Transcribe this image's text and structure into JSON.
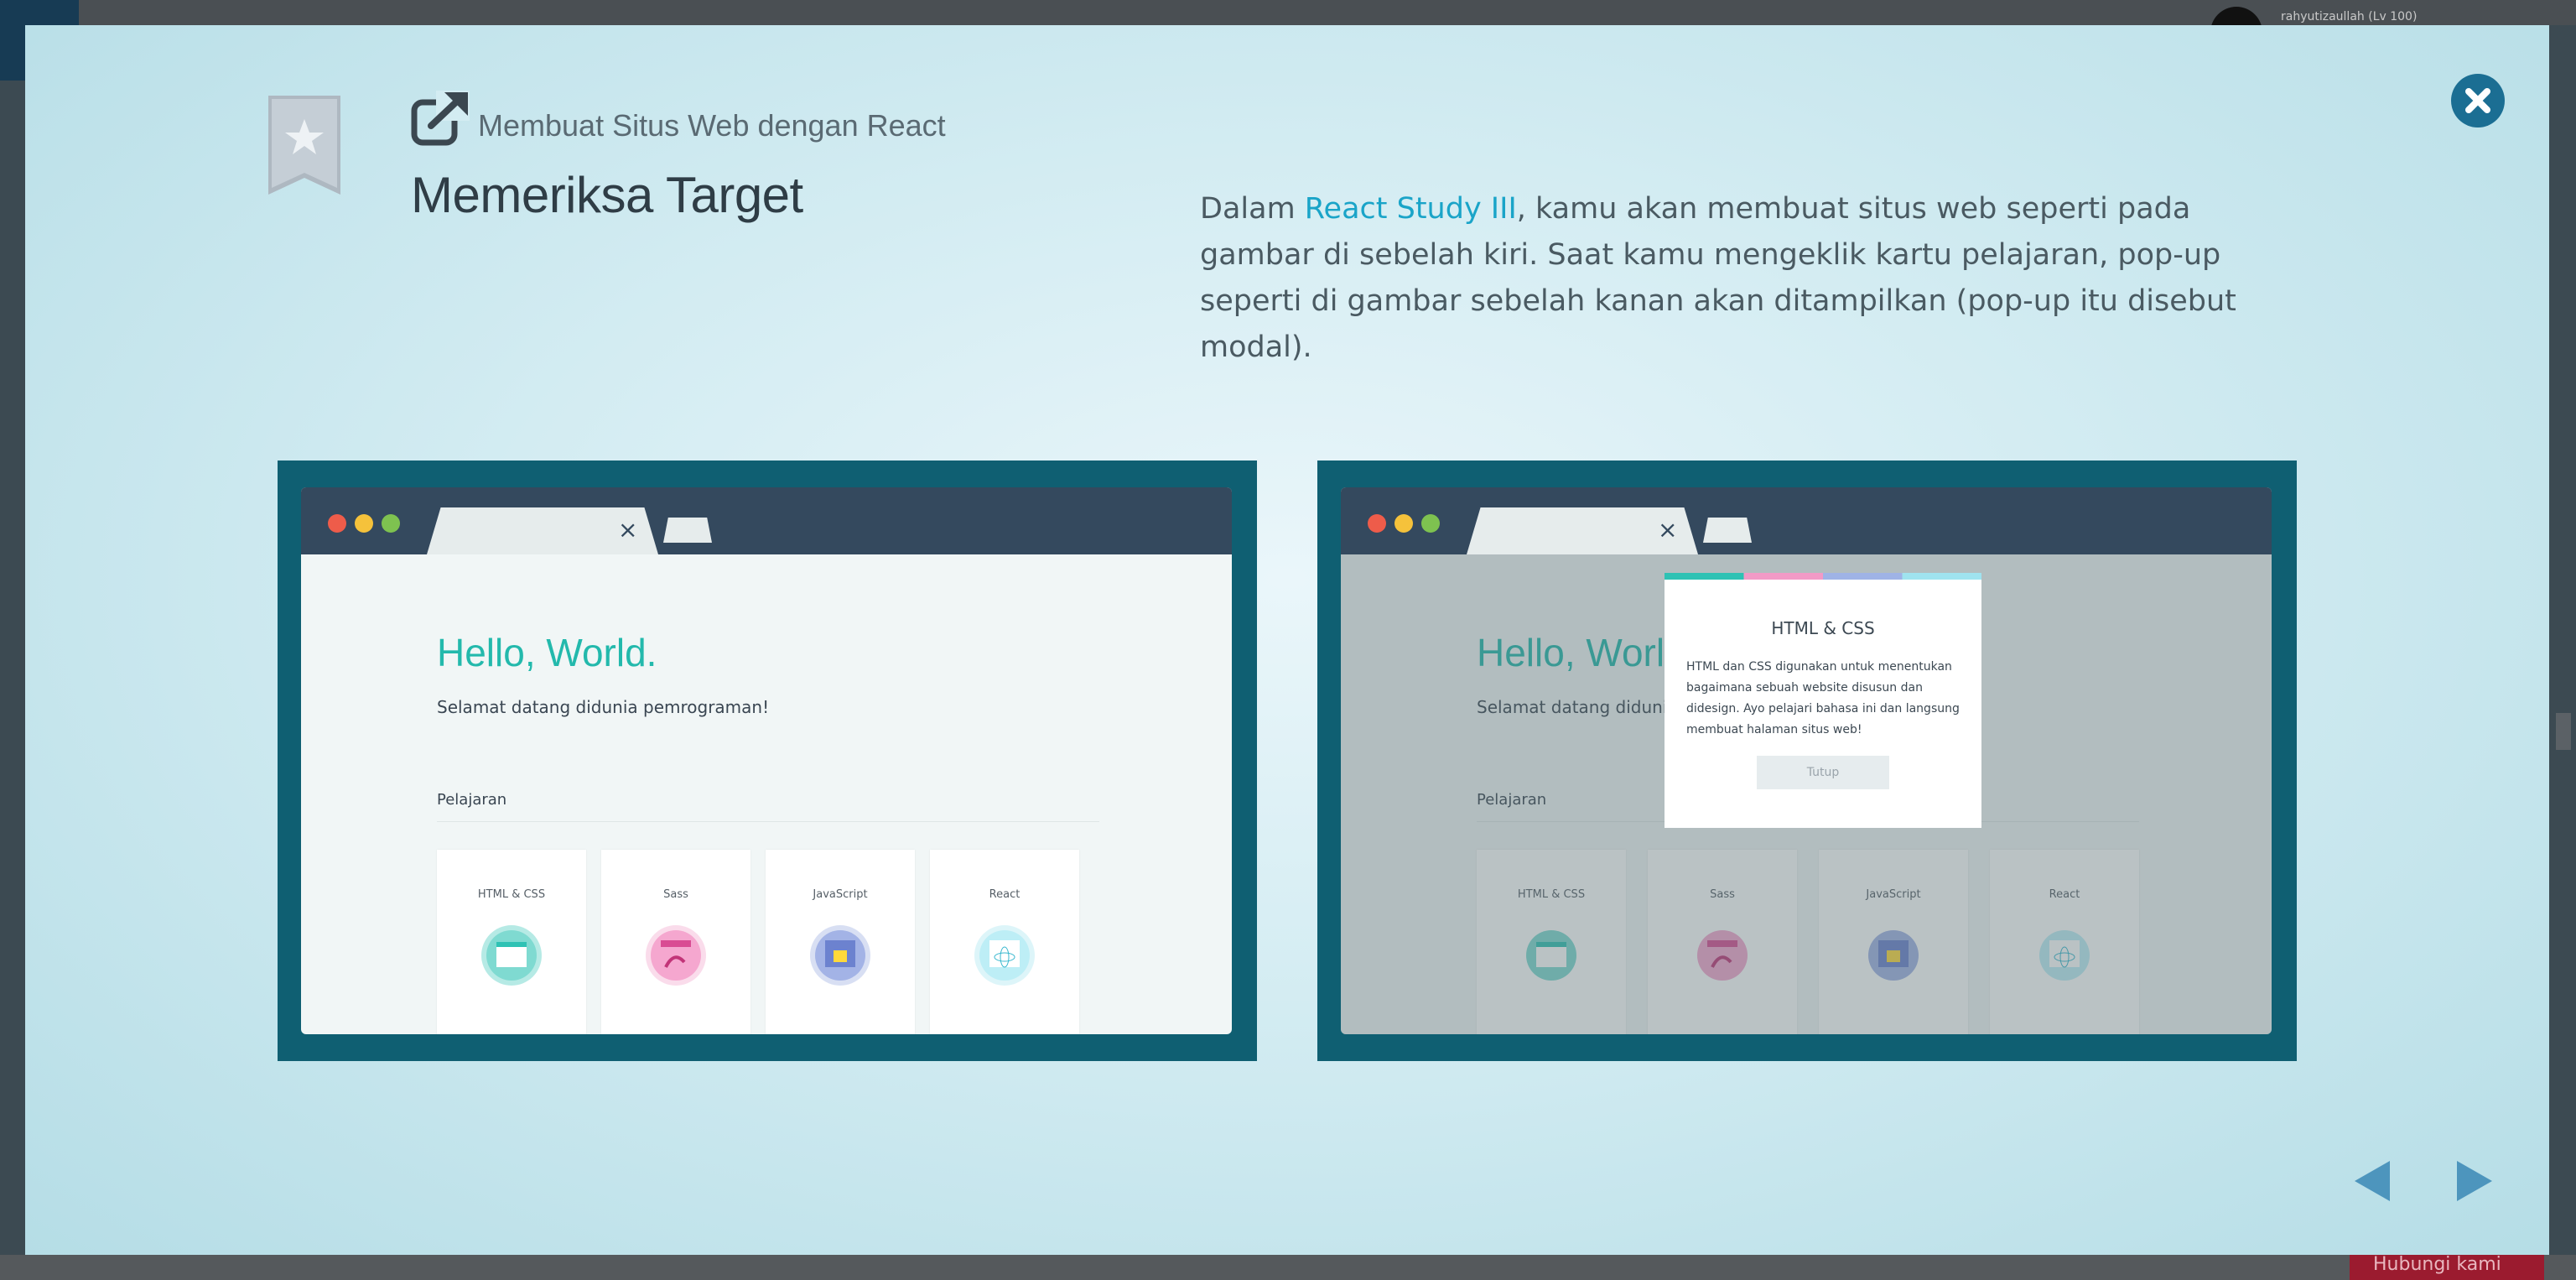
{
  "background": {
    "username": "rahyutizaullah (Lv 100)",
    "help_button": "Hubungi kami"
  },
  "modal": {
    "chapter_title": "Membuat Situs Web dengan React",
    "slide_title": "Memeriksa Target",
    "description": {
      "prefix": "Dalam ",
      "link_text": "React Study III",
      "suffix": ", kamu akan membuat situs web seperti pada gambar di sebelah kiri. Saat kamu mengeklik kartu pelajaran, pop-up seperti di gambar sebelah kanan akan ditampilkan (pop-up itu disebut modal)."
    },
    "close_icon": "close-circle-icon",
    "prev_icon": "triangle-left-icon",
    "next_icon": "triangle-right-icon"
  },
  "left_shot": {
    "tab_close": "×",
    "hello": "Hello, World.",
    "welcome": "Selamat datang didunia pemrograman!",
    "lessons_label": "Pelajaran",
    "cards": [
      {
        "title": "HTML & CSS",
        "color": "#2fc2b4"
      },
      {
        "title": "Sass",
        "color": "#f29ac6"
      },
      {
        "title": "JavaScript",
        "color": "#8fa3de"
      },
      {
        "title": "React",
        "color": "#9fe3ef"
      }
    ]
  },
  "right_shot": {
    "tab_close": "×",
    "hello": "Hello, World.",
    "welcome": "Selamat datang didunia pemrograman!",
    "lessons_label": "Pelajaran",
    "cards": [
      {
        "title": "HTML & CSS",
        "color": "#2fc2b4"
      },
      {
        "title": "Sass",
        "color": "#f29ac6"
      },
      {
        "title": "JavaScript",
        "color": "#8fa3de"
      },
      {
        "title": "React",
        "color": "#9fe3ef"
      }
    ],
    "modal": {
      "title": "HTML & CSS",
      "text": "HTML dan CSS digunakan untuk menentukan bagaimana sebuah website disusun dan didesign. Ayo pelajari bahasa ini dan langsung membuat halaman situs web!",
      "button": "Tutup"
    }
  }
}
